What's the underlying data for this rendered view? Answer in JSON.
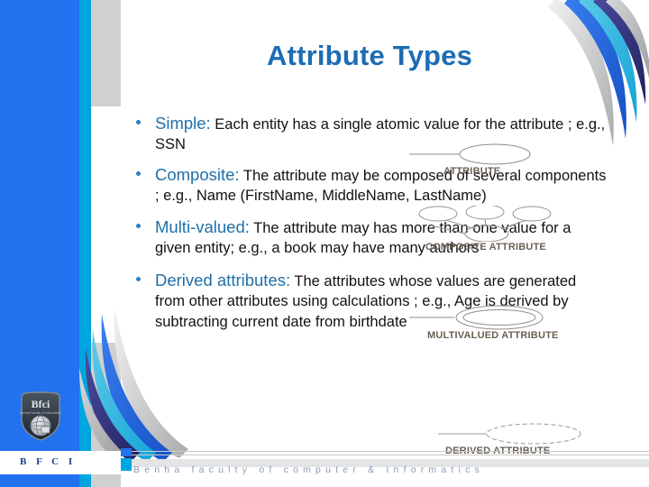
{
  "slide": {
    "title": "Attribute Types",
    "bullets": [
      {
        "keyword": "Simple:",
        "text": " Each entity has a single atomic value for the attribute ; e.g., SSN"
      },
      {
        "keyword": "Composite:",
        "text": " The attribute may be composed of several components ; e.g., Name (FirstName, MiddleName, LastName)"
      },
      {
        "keyword": "Multi-valued:",
        "text": " The attribute may has more than one value for a given entity; e.g., a book may have many authors"
      },
      {
        "keyword": "Derived attributes:",
        "text": " The attributes whose values are generated from other attributes using calculations ; e.g., Age is derived by subtracting current date from birthdate"
      }
    ],
    "diagram_labels": {
      "attribute": "ATTRIBUTE",
      "composite": "COMPOSITE ATTRIBUTE",
      "multivalued": "MULTIVALUED ATTRIBUTE",
      "derived": "DERIVED ATTRIBUTE"
    },
    "footer": {
      "text": "Benha faculty of computer & Informatics",
      "logo_text": "B F C I",
      "logo_mark": "Bfci"
    },
    "colors": {
      "title_blue": "#1d6cb4",
      "keyword_blue": "#1f6fa8",
      "band_blue": "#2272f0",
      "band_cyan": "#00a5e0",
      "band_gray": "#cfd0d1",
      "body_text": "#121212",
      "diagram_label": "#6a6054",
      "footer_text": "#8d9bb5"
    }
  }
}
